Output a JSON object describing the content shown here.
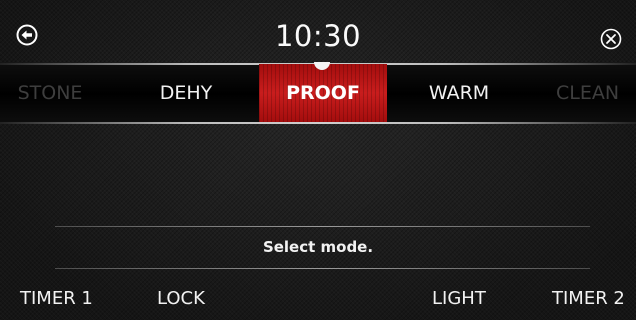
{
  "header": {
    "time": "10:30",
    "back_icon": "back-arrow-circle-icon",
    "close_icon": "close-circle-icon"
  },
  "modes": {
    "items": [
      "STONE",
      "DEHY",
      "PROOF",
      "WARM",
      "CLEAN"
    ],
    "selected": "PROOF"
  },
  "status": {
    "message": "Select mode."
  },
  "footer": {
    "timer1": "TIMER 1",
    "lock": "LOCK",
    "light": "LIGHT",
    "timer2": "TIMER 2"
  },
  "colors": {
    "selected_mode_bg": "#c91d1d",
    "text": "#f2f2f2",
    "inactive_mode_text": "#3e3e3e"
  }
}
